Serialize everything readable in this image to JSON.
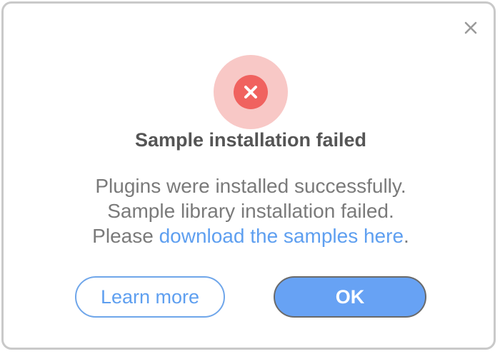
{
  "dialog": {
    "title": "Sample installation failed",
    "message_line1": "Plugins were installed successfully.",
    "message_line2": "Sample library installation failed.",
    "message_line3_prefix": "Please ",
    "message_link": "download the samples here",
    "message_line3_suffix": ".",
    "status_icon": "error-x-icon",
    "close_icon": "close-icon"
  },
  "buttons": {
    "learn_more": "Learn more",
    "ok": "OK"
  },
  "colors": {
    "error_outer": "#f8c8c6",
    "error_inner": "#f0625f",
    "accent_blue": "#5e9ff0",
    "ok_fill": "#67a2f4",
    "text_gray": "#7a7a7a",
    "title_gray": "#555555"
  }
}
